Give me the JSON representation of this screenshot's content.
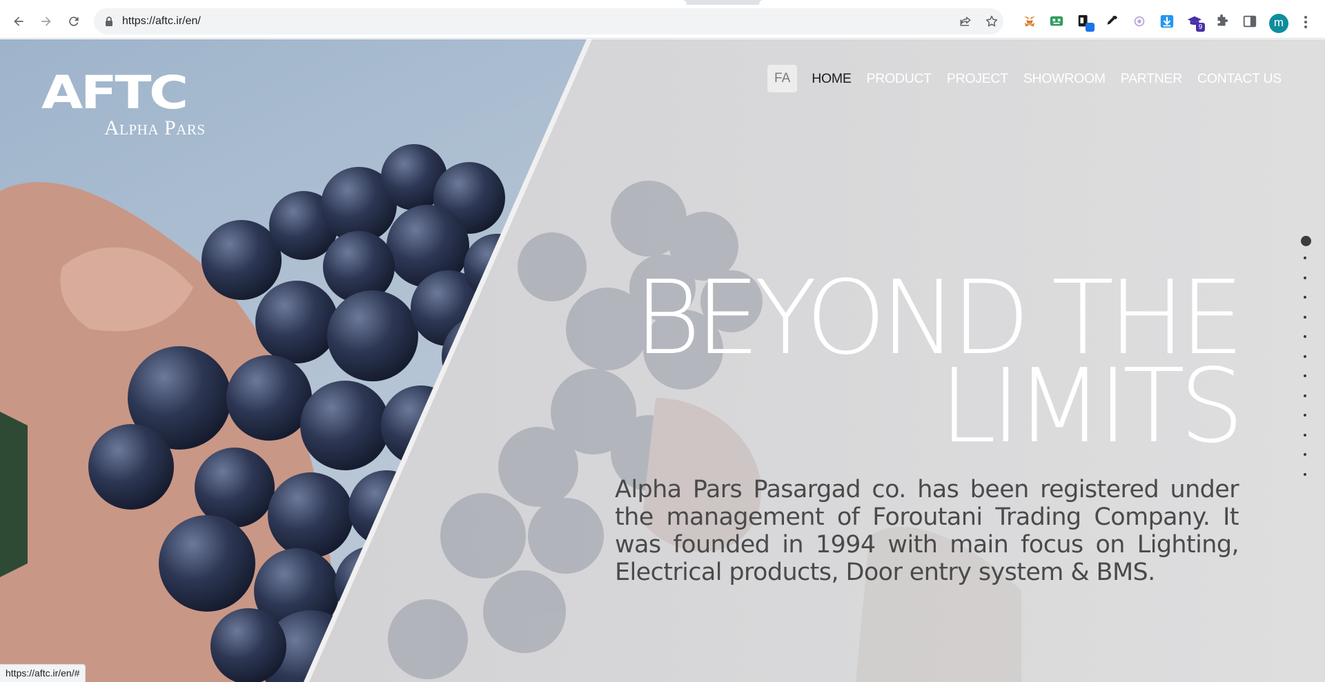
{
  "browser": {
    "url": "https://aftc.ir/en/",
    "status_url": "https://aftc.ir/en/#",
    "profile_initial": "m",
    "extension_badges": {
      "ext_7": "9"
    }
  },
  "site": {
    "logo_mark": "AFTC",
    "logo_sub": "Alpha Pars",
    "nav": {
      "lang": "FA",
      "items": [
        "HOME",
        "PRODUCT",
        "PROJECT",
        "SHOWROOM",
        "PARTNER",
        "CONTACT US"
      ]
    },
    "headline_line1": "BEYOND THE",
    "headline_line2": "LIMITS",
    "intro": "Alpha Pars Pasargad co. has been registered under the management of Foroutani Trading Company. It was founded in 1994 with main focus on Lighting, Electrical products, Door entry system & BMS.",
    "section_dots": {
      "count": 13,
      "active": 1
    }
  },
  "colors": {
    "accent_dark": "#1c1c1c",
    "intro_text": "#4a4a4a",
    "avatar": "#0e8d9b"
  }
}
